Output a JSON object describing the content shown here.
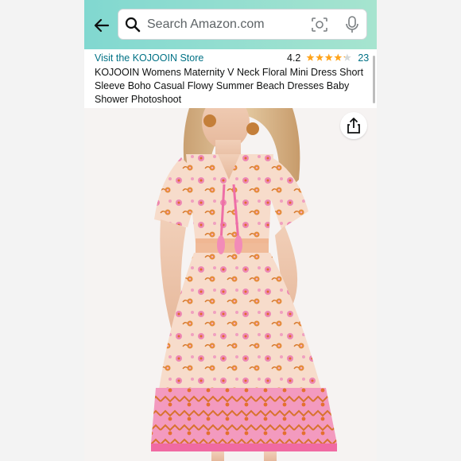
{
  "header": {
    "back_icon": "arrow-left-icon",
    "search_placeholder": "Search Amazon.com",
    "icons": [
      "search-icon",
      "camera-scan-icon",
      "microphone-icon"
    ],
    "bg_color": "#8fdcd0"
  },
  "product": {
    "store_link": "Visit the KOJOOIN Store",
    "rating_value": "4.2",
    "rating_stars": 4.2,
    "rating_count": "23",
    "title": "KOJOOIN Womens Maternity V Neck Floral Mini Dress Short Sleeve Boho Casual Flowy Summer Beach Dresses Baby Shower Photoshoot",
    "link_color": "#007185",
    "star_color": "#ffa41c"
  },
  "image": {
    "share_icon": "share-icon",
    "dress_colors": [
      "#f3a7c4",
      "#e07a3a",
      "#f7d9c0"
    ]
  }
}
